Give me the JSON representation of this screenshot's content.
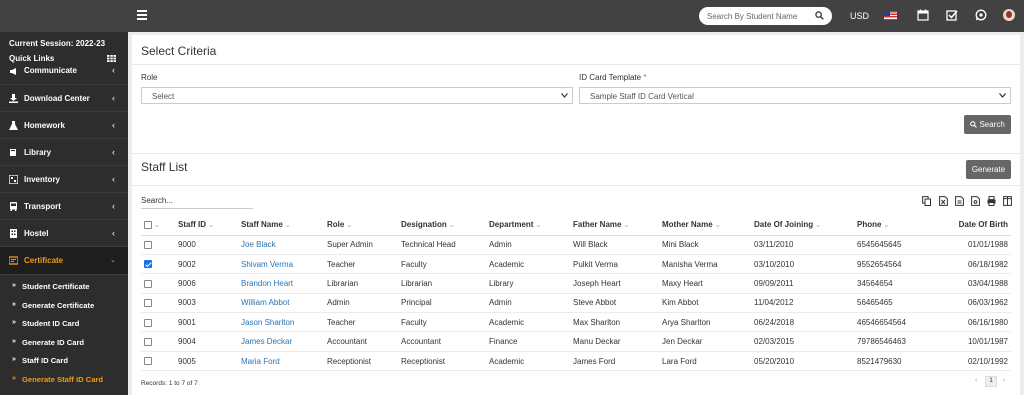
{
  "topbar": {
    "search_placeholder": "Search By Student Name",
    "currency": "USD"
  },
  "sidebar": {
    "session": "Current Session: 2022-23",
    "quick_links": "Quick Links",
    "items": [
      {
        "label": "Communicate",
        "icon": "megaphone-icon"
      },
      {
        "label": "Download Center",
        "icon": "download-icon"
      },
      {
        "label": "Homework",
        "icon": "flask-icon"
      },
      {
        "label": "Library",
        "icon": "book-icon"
      },
      {
        "label": "Inventory",
        "icon": "inventory-icon"
      },
      {
        "label": "Transport",
        "icon": "bus-icon"
      },
      {
        "label": "Hostel",
        "icon": "building-icon"
      },
      {
        "label": "Certificate",
        "icon": "certificate-icon"
      }
    ],
    "subitems": [
      {
        "label": "Student Certificate"
      },
      {
        "label": "Generate Certificate"
      },
      {
        "label": "Student ID Card"
      },
      {
        "label": "Generate ID Card"
      },
      {
        "label": "Staff ID Card"
      },
      {
        "label": "Generate Staff ID Card"
      }
    ]
  },
  "criteria": {
    "title": "Select Criteria",
    "role_label": "Role",
    "role_value": "Select",
    "template_label": "ID Card Template",
    "template_value": "Sample Staff ID Card Vertical",
    "search_button": "Search"
  },
  "staff": {
    "title": "Staff List",
    "generate_button": "Generate",
    "search_placeholder": "Search...",
    "columns": [
      "Staff ID",
      "Staff Name",
      "Role",
      "Designation",
      "Department",
      "Father Name",
      "Mother Name",
      "Date Of Joining",
      "Phone",
      "Date Of Birth"
    ],
    "rows": [
      {
        "checked": false,
        "id": "9000",
        "name": "Joe Black",
        "role": "Super Admin",
        "designation": "Technical Head",
        "department": "Admin",
        "father": "Will Black",
        "mother": "Mini Black",
        "doj": "03/11/2010",
        "phone": "6545645645",
        "dob": "01/01/1988"
      },
      {
        "checked": true,
        "id": "9002",
        "name": "Shivam Verma",
        "role": "Teacher",
        "designation": "Faculty",
        "department": "Academic",
        "father": "Pulkit Verma",
        "mother": "Manisha Verma",
        "doj": "03/10/2010",
        "phone": "9552654564",
        "dob": "06/18/1982"
      },
      {
        "checked": false,
        "id": "9006",
        "name": "Brandon Heart",
        "role": "Librarian",
        "designation": "Librarian",
        "department": "Library",
        "father": "Joseph Heart",
        "mother": "Maxy Heart",
        "doj": "09/09/2011",
        "phone": "34564654",
        "dob": "03/04/1988"
      },
      {
        "checked": false,
        "id": "9003",
        "name": "William Abbot",
        "role": "Admin",
        "designation": "Principal",
        "department": "Admin",
        "father": "Steve Abbot",
        "mother": "Kim Abbot",
        "doj": "11/04/2012",
        "phone": "56465465",
        "dob": "06/03/1962"
      },
      {
        "checked": false,
        "id": "9001",
        "name": "Jason Sharlton",
        "role": "Teacher",
        "designation": "Faculty",
        "department": "Academic",
        "father": "Max Sharlton",
        "mother": "Arya Sharlton",
        "doj": "06/24/2018",
        "phone": "46546654564",
        "dob": "06/16/1980"
      },
      {
        "checked": false,
        "id": "9004",
        "name": "James Deckar",
        "role": "Accountant",
        "designation": "Accountant",
        "department": "Finance",
        "father": "Manu Deckar",
        "mother": "Jen Deckar",
        "doj": "02/03/2015",
        "phone": "79786546463",
        "dob": "10/01/1987"
      },
      {
        "checked": false,
        "id": "9005",
        "name": "Maria Ford",
        "role": "Receptionist",
        "designation": "Receptionist",
        "department": "Academic",
        "father": "James Ford",
        "mother": "Lara Ford",
        "doj": "05/20/2010",
        "phone": "8521479630",
        "dob": "02/10/1992"
      }
    ],
    "records": "Records: 1 to 7 of 7",
    "page": "1"
  },
  "colors": {
    "topbar": "#424242",
    "sidebar": "#2d2d2d",
    "accent": "#f39c12",
    "link": "#2a74b7",
    "button": "#666666"
  }
}
